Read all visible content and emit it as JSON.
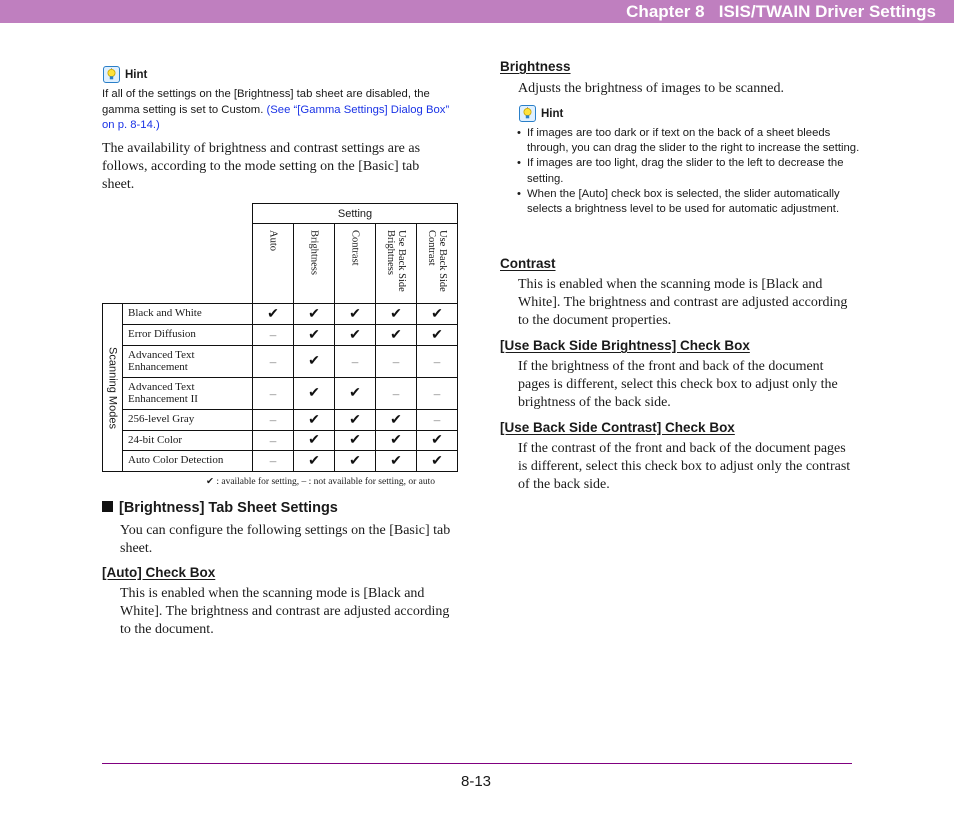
{
  "header": {
    "chapter_title": "Chapter 8   ISIS/TWAIN Driver Settings",
    "bar_color": "#bf7fbf"
  },
  "left": {
    "hint": {
      "label": "Hint",
      "text": "If all of the settings on the [Brightness] tab sheet are disabled, the gamma setting is set to Custom. ",
      "link": "(See “[Gamma Settings] Dialog Box” on p. 8-14.)"
    },
    "intro": "The availability of brightness and contrast settings are as follows, according to the mode setting on the [Basic] tab sheet.",
    "table": {
      "group_header": "Setting",
      "side_label": "Scanning Modes",
      "columns": [
        "Auto",
        "Brightness",
        "Contrast",
        "Use Back Side\nBrightness",
        "Use Back Side\nContrast"
      ],
      "rows": [
        {
          "mode": "Black and White",
          "values": [
            "✔",
            "✔",
            "✔",
            "✔",
            "✔"
          ]
        },
        {
          "mode": "Error Diffusion",
          "values": [
            "–",
            "✔",
            "✔",
            "✔",
            "✔"
          ]
        },
        {
          "mode": "Advanced Text Enhancement",
          "values": [
            "–",
            "✔",
            "–",
            "–",
            "–"
          ]
        },
        {
          "mode": "Advanced Text Enhancement II",
          "values": [
            "–",
            "✔",
            "✔",
            "–",
            "–"
          ]
        },
        {
          "mode": "256-level Gray",
          "values": [
            "–",
            "✔",
            "✔",
            "✔",
            "–"
          ]
        },
        {
          "mode": "24-bit Color",
          "values": [
            "–",
            "✔",
            "✔",
            "✔",
            "✔"
          ]
        },
        {
          "mode": "Auto Color Detection",
          "values": [
            "–",
            "✔",
            "✔",
            "✔",
            "✔"
          ]
        }
      ],
      "legend": "✔ : available for setting, – : not available for setting, or auto"
    },
    "section_title": "[Brightness] Tab Sheet Settings",
    "section_intro": "You can configure the following settings on the [Basic] tab sheet.",
    "auto_heading": "[Auto] Check Box",
    "auto_text": "This is enabled when the scanning mode is [Black and White]. The brightness and contrast are adjusted according to the document."
  },
  "right": {
    "brightness_heading": "Brightness",
    "brightness_text": "Adjusts the brightness of images to be scanned.",
    "hint_label": "Hint",
    "hint_items": [
      "If images are too dark or if text on the back of a sheet bleeds through, you can drag the slider to the right to increase the setting.",
      "If images are too light, drag the slider to the left to decrease the setting.",
      "When the [Auto] check box is selected, the slider automatically selects a brightness level to be used for automatic adjustment."
    ],
    "contrast_heading": "Contrast",
    "contrast_text": "This is enabled when the scanning mode is [Black and White]. The brightness and contrast are adjusted according to the document properties.",
    "back_brightness_heading": "[Use Back Side Brightness] Check Box",
    "back_brightness_text": "If the brightness of the front and back of the document pages is different, select this check box to adjust only the brightness of the back side.",
    "back_contrast_heading": "[Use Back Side Contrast] Check Box",
    "back_contrast_text": "If the contrast of the front and back of the document pages is different, select this check box to adjust only the contrast of the back side."
  },
  "footer": {
    "page_number": "8-13"
  }
}
